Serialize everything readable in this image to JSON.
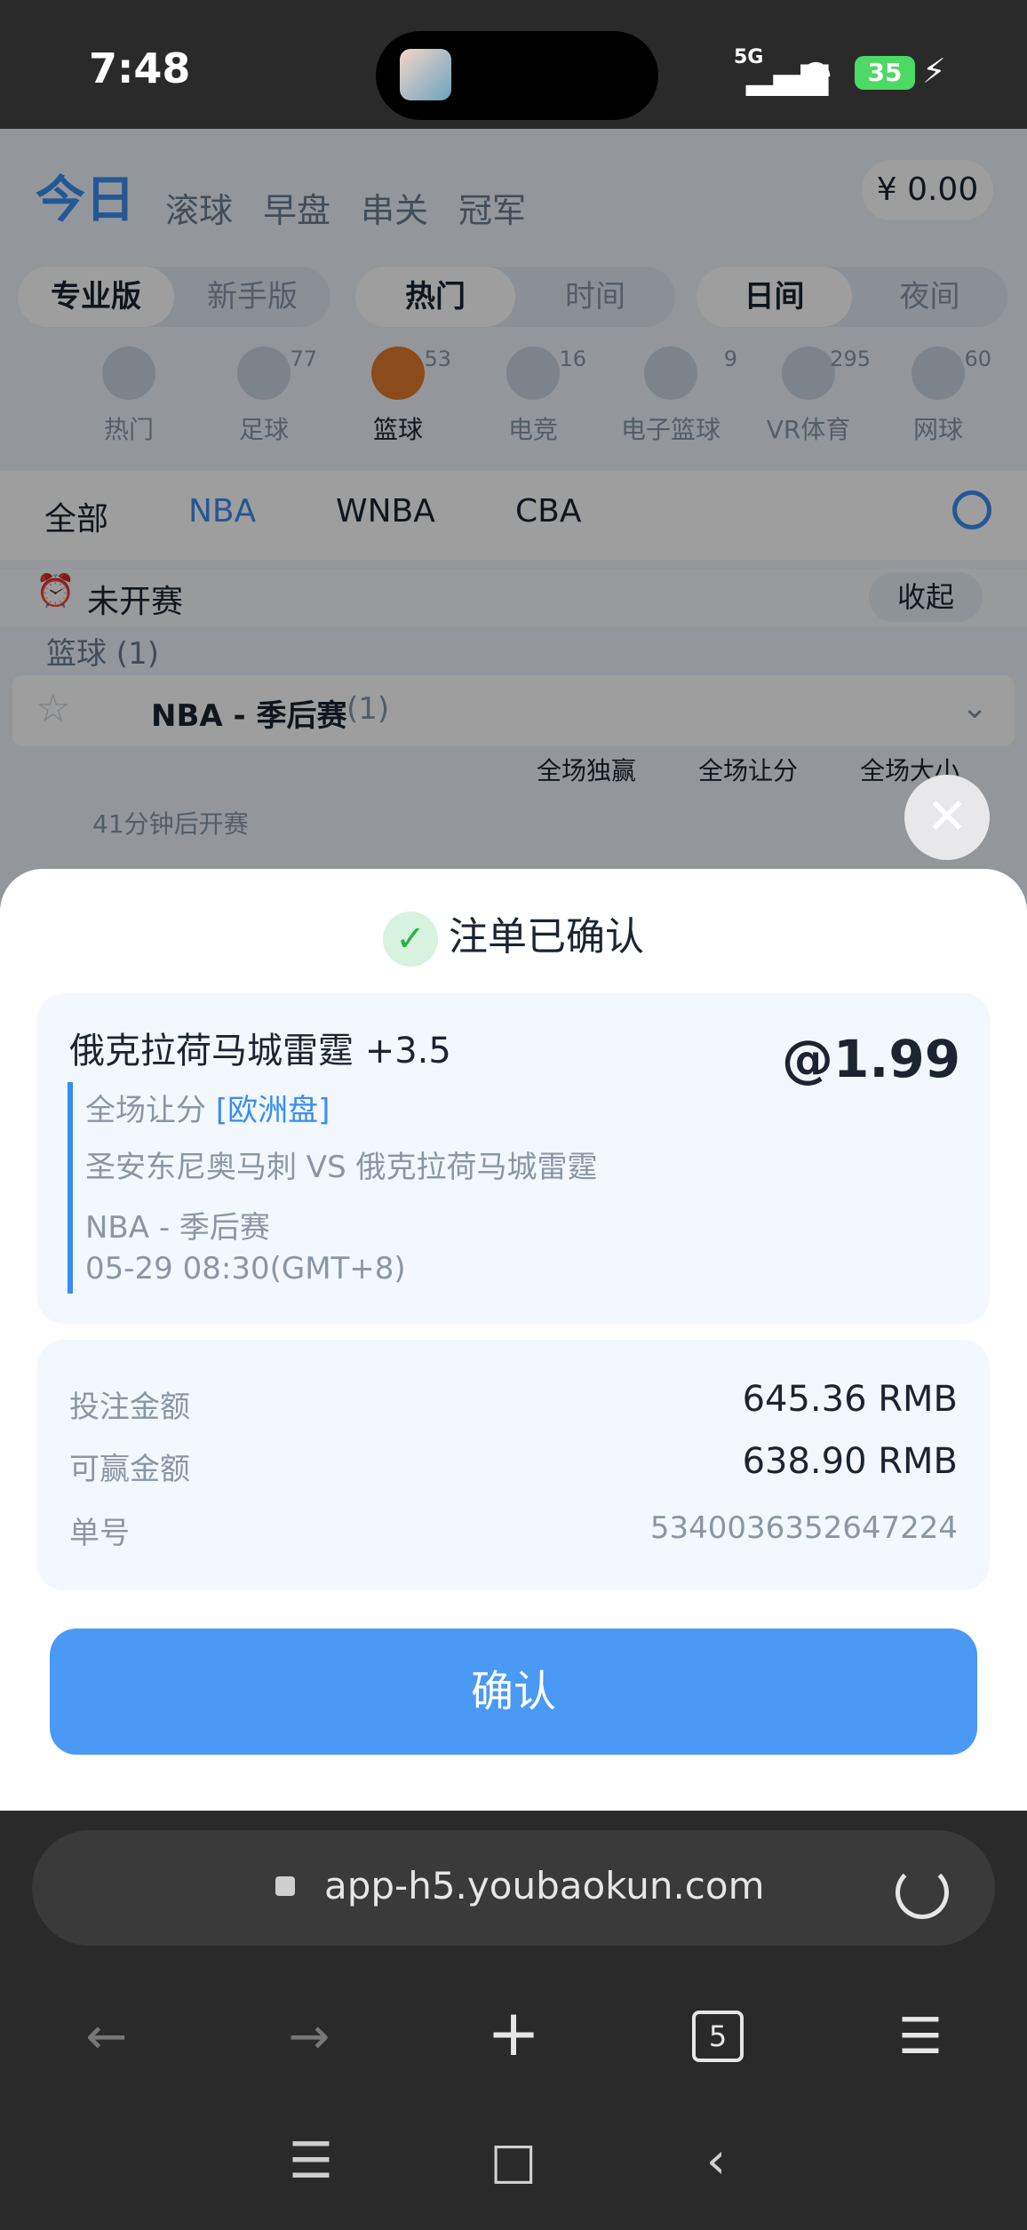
{
  "status_bar": {
    "time": "7:48",
    "network": "5G",
    "battery": "35"
  },
  "app_header": {
    "tabs": [
      "今日",
      "滚球",
      "早盘",
      "串关",
      "冠军"
    ],
    "balance": "¥ 0.00"
  },
  "filters": {
    "mode": [
      "专业版",
      "新手版"
    ],
    "sort": [
      "热门",
      "时间"
    ],
    "daynight": [
      "日间",
      "夜间"
    ]
  },
  "sports": [
    {
      "label": "热门",
      "count": ""
    },
    {
      "label": "足球",
      "count": "77"
    },
    {
      "label": "篮球",
      "count": "53"
    },
    {
      "label": "电竞",
      "count": "16"
    },
    {
      "label": "电子篮球",
      "count": "9"
    },
    {
      "label": "VR体育",
      "count": "295"
    },
    {
      "label": "网球",
      "count": "60"
    }
  ],
  "leagues": [
    "全部",
    "NBA",
    "WNBA",
    "CBA"
  ],
  "section": {
    "not_started": "未开赛",
    "collapse": "收起",
    "basketball": "篮球 (1)",
    "league_title": "NBA - 季后赛",
    "league_count": "(1)",
    "columns": [
      "全场独赢",
      "全场让分",
      "全场大小"
    ],
    "start_info": "41分钟后开赛"
  },
  "modal": {
    "title": "注单已确认",
    "selection": "俄克拉荷马城雷霆 +3.5",
    "odds": "@1.99",
    "market": "全场让分",
    "market_type": "[欧洲盘]",
    "match": "圣安东尼奥马刺 VS 俄克拉荷马城雷霆",
    "league": "NBA - 季后赛",
    "time": "05-29 08:30(GMT+8)",
    "stake_label": "投注金额",
    "stake_value": "645.36 RMB",
    "win_label": "可赢金额",
    "win_value": "638.90 RMB",
    "order_label": "单号",
    "order_value": "5340036352647224",
    "confirm_button": "确认"
  },
  "browser": {
    "url": "app-h5.youbaokun.com",
    "tab_count": "5"
  },
  "colors": {
    "accent": "#3a8df0",
    "button": "#4a99f5",
    "success": "#2bb24c"
  }
}
